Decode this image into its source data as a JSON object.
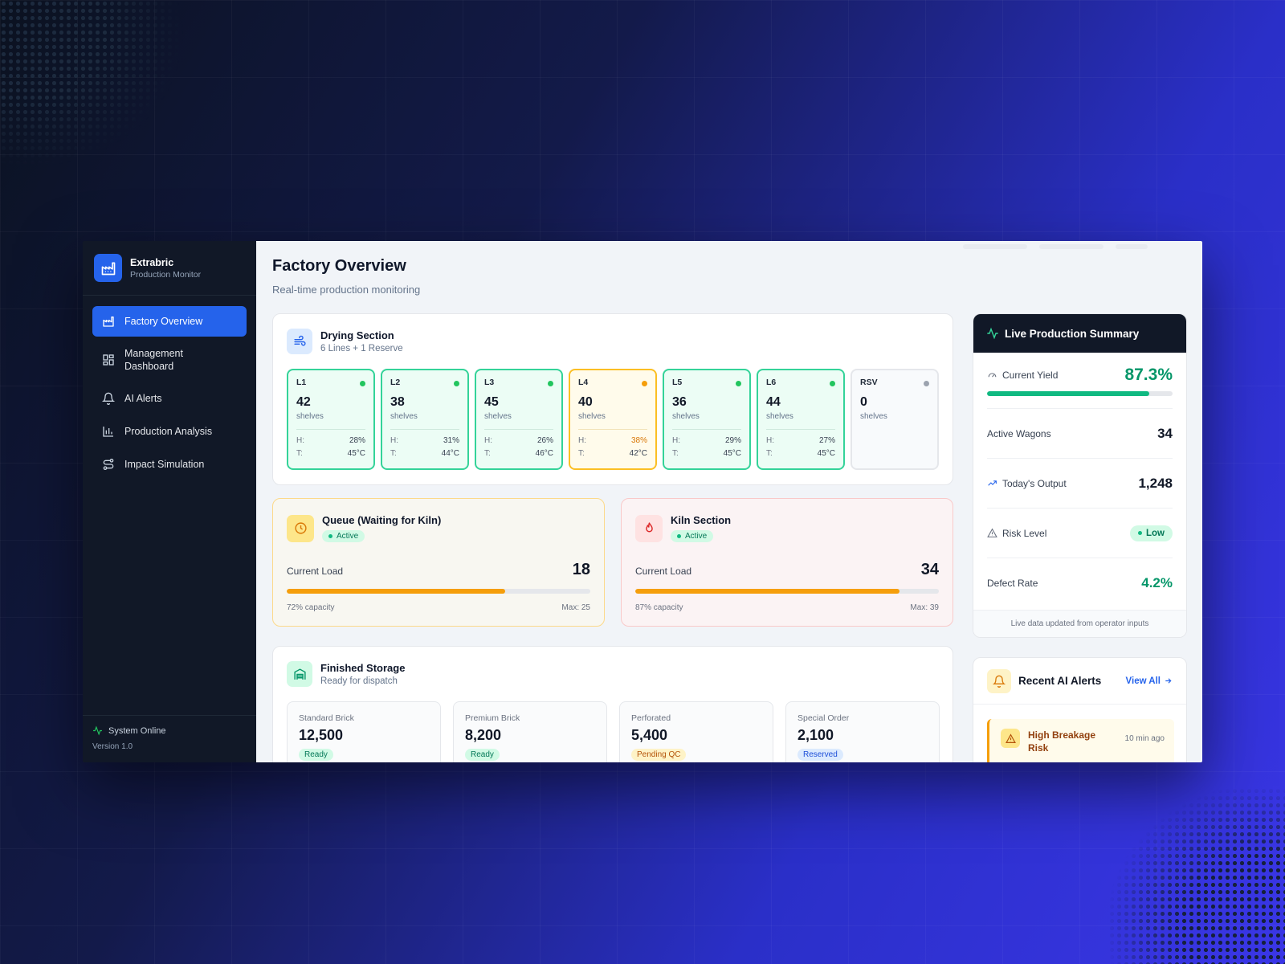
{
  "brand": {
    "name": "Extrabric",
    "subtitle": "Production Monitor"
  },
  "nav": [
    {
      "label": "Factory Overview",
      "active": true
    },
    {
      "label": "Management Dashboard"
    },
    {
      "label": "AI Alerts"
    },
    {
      "label": "Production Analysis"
    },
    {
      "label": "Impact Simulation"
    }
  ],
  "sidebar_footer": {
    "status": "System Online",
    "version": "Version 1.0"
  },
  "page": {
    "title": "Factory Overview",
    "subtitle": "Real-time production monitoring"
  },
  "drying": {
    "title": "Drying Section",
    "subtitle": "6 Lines + 1 Reserve",
    "unit": "shelves",
    "h_label": "H:",
    "t_label": "T:",
    "lines": [
      {
        "id": "L1",
        "shelves": "42",
        "humidity": "28%",
        "temp": "45°C",
        "status": "ok"
      },
      {
        "id": "L2",
        "shelves": "38",
        "humidity": "31%",
        "temp": "44°C",
        "status": "ok"
      },
      {
        "id": "L3",
        "shelves": "45",
        "humidity": "26%",
        "temp": "46°C",
        "status": "ok"
      },
      {
        "id": "L4",
        "shelves": "40",
        "humidity": "38%",
        "temp": "42°C",
        "status": "warn"
      },
      {
        "id": "L5",
        "shelves": "36",
        "humidity": "29%",
        "temp": "45°C",
        "status": "ok"
      },
      {
        "id": "L6",
        "shelves": "44",
        "humidity": "27%",
        "temp": "45°C",
        "status": "ok"
      },
      {
        "id": "RSV",
        "shelves": "0",
        "status": "reserve"
      }
    ]
  },
  "queue": {
    "title": "Queue (Waiting for Kiln)",
    "status": "Active",
    "load_label": "Current Load",
    "load": "18",
    "capacity_pct": 72,
    "capacity_text": "72% capacity",
    "max_text": "Max: 25"
  },
  "kiln": {
    "title": "Kiln Section",
    "status": "Active",
    "load_label": "Current Load",
    "load": "34",
    "capacity_pct": 87,
    "capacity_text": "87% capacity",
    "max_text": "Max: 39"
  },
  "storage": {
    "title": "Finished Storage",
    "subtitle": "Ready for dispatch",
    "items": [
      {
        "name": "Standard Brick",
        "value": "12,500",
        "status": "Ready",
        "color": "#047857",
        "bg": "#d1fae5"
      },
      {
        "name": "Premium Brick",
        "value": "8,200",
        "status": "Ready",
        "color": "#047857",
        "bg": "#d1fae5"
      },
      {
        "name": "Perforated",
        "value": "5,400",
        "status": "Pending QC",
        "color": "#b45309",
        "bg": "#fef3c7"
      },
      {
        "name": "Special Order",
        "value": "2,100",
        "status": "Reserved",
        "color": "#1d4ed8",
        "bg": "#dbeafe"
      }
    ]
  },
  "summary": {
    "title": "Live Production Summary",
    "yield_label": "Current Yield",
    "yield": "87.3%",
    "yield_pct": 87.3,
    "wagons_label": "Active Wagons",
    "wagons": "34",
    "output_label": "Today's Output",
    "output": "1,248",
    "risk_label": "Risk Level",
    "risk": "Low",
    "defect_label": "Defect Rate",
    "defect": "4.2%",
    "footer": "Live data updated from operator inputs"
  },
  "alerts": {
    "title": "Recent AI Alerts",
    "view_all": "View All",
    "items": [
      {
        "title": "High Breakage Risk",
        "time": "10 min ago"
      }
    ]
  },
  "colors": {
    "accent": "#2563eb",
    "ok": "#10b981",
    "warn": "#f59e0b",
    "sidebar": "#111827"
  }
}
